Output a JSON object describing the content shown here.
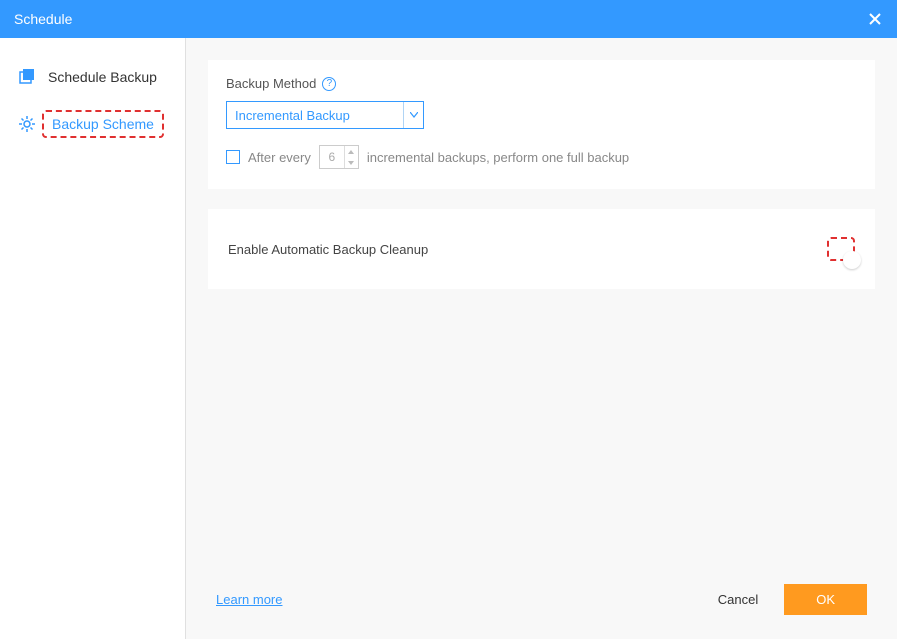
{
  "titlebar": {
    "title": "Schedule"
  },
  "sidebar": {
    "items": [
      {
        "label": "Schedule Backup",
        "icon": "backup-icon"
      },
      {
        "label": "Backup Scheme",
        "icon": "gear-icon"
      }
    ]
  },
  "main": {
    "backup_method": {
      "label": "Backup Method",
      "selected": "Incremental Backup"
    },
    "after_every": {
      "prefix": "After every",
      "value": "6",
      "suffix": "incremental backups, perform one full backup"
    },
    "cleanup": {
      "label": "Enable Automatic Backup Cleanup"
    }
  },
  "footer": {
    "learn_more": "Learn more",
    "cancel": "Cancel",
    "ok": "OK"
  }
}
